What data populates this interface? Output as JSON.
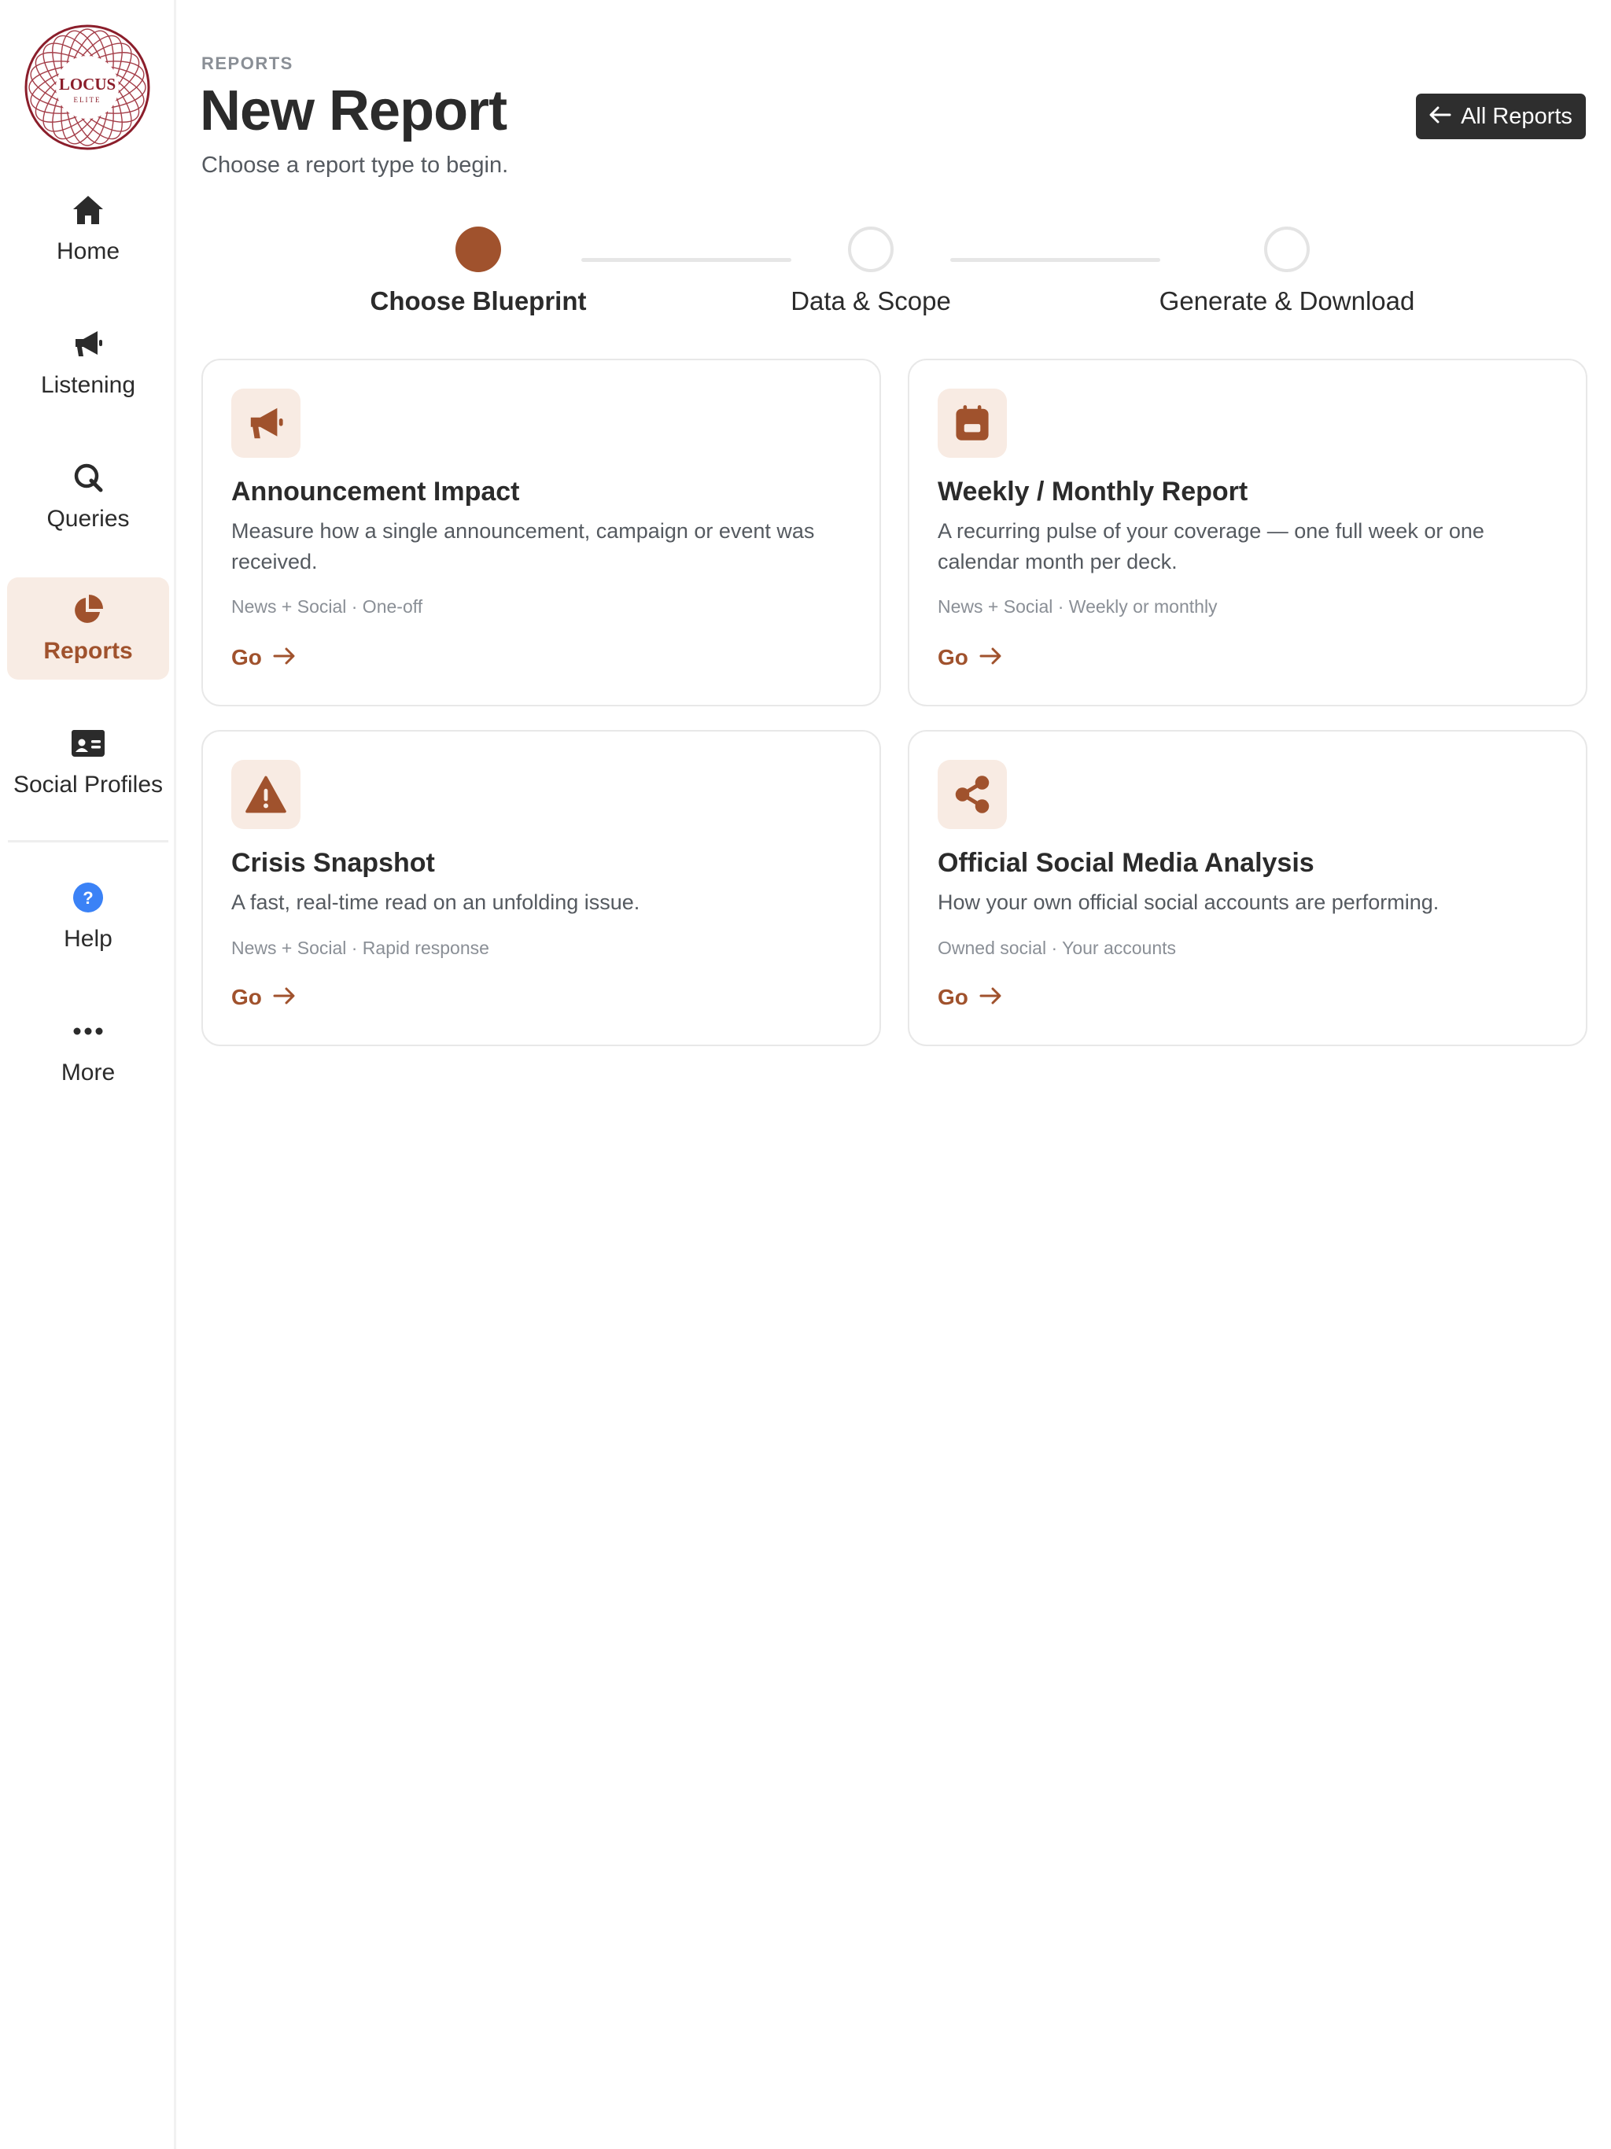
{
  "brand": {
    "logo_text": "LOCUS",
    "logo_subtext": "ELITE",
    "accent_color": "#a0522d"
  },
  "sidebar": {
    "items": [
      {
        "label": "Home",
        "icon": "home-icon"
      },
      {
        "label": "Listening",
        "icon": "megaphone-icon"
      },
      {
        "label": "Queries",
        "icon": "query-icon"
      },
      {
        "label": "Reports",
        "icon": "pie-chart-icon",
        "active": true
      },
      {
        "label": "Social Profiles",
        "icon": "id-card-icon"
      },
      {
        "label": "Help",
        "icon": "help-icon"
      },
      {
        "label": "More",
        "icon": "ellipsis-icon"
      }
    ]
  },
  "header": {
    "eyebrow": "REPORTS",
    "title": "New Report",
    "subtitle": "Choose a report type to begin.",
    "all_reports_label": "All Reports"
  },
  "stepper": {
    "steps": [
      {
        "label": "Choose Blueprint",
        "state": "current"
      },
      {
        "label": "Data & Scope",
        "state": "upcoming"
      },
      {
        "label": "Generate & Download",
        "state": "upcoming"
      }
    ]
  },
  "cards": [
    {
      "title": "Announcement Impact",
      "description": "Measure how a single announcement, campaign or event was received.",
      "tags": "News + Social · One-off",
      "go_label": "Go",
      "icon": "megaphone-icon"
    },
    {
      "title": "Weekly / Monthly Report",
      "description": "A recurring pulse of your coverage — one full week or one calendar month per deck.",
      "tags": "News + Social · Weekly or monthly",
      "go_label": "Go",
      "icon": "calendar-icon"
    },
    {
      "title": "Crisis Snapshot",
      "description": "A fast, real-time read on an unfolding issue.",
      "tags": "News + Social · Rapid response",
      "go_label": "Go",
      "icon": "warning-icon"
    },
    {
      "title": "Official Social Media Analysis",
      "description": "How your own official social accounts are performing.",
      "tags": "Owned social · Your accounts",
      "go_label": "Go",
      "icon": "share-icon"
    }
  ]
}
